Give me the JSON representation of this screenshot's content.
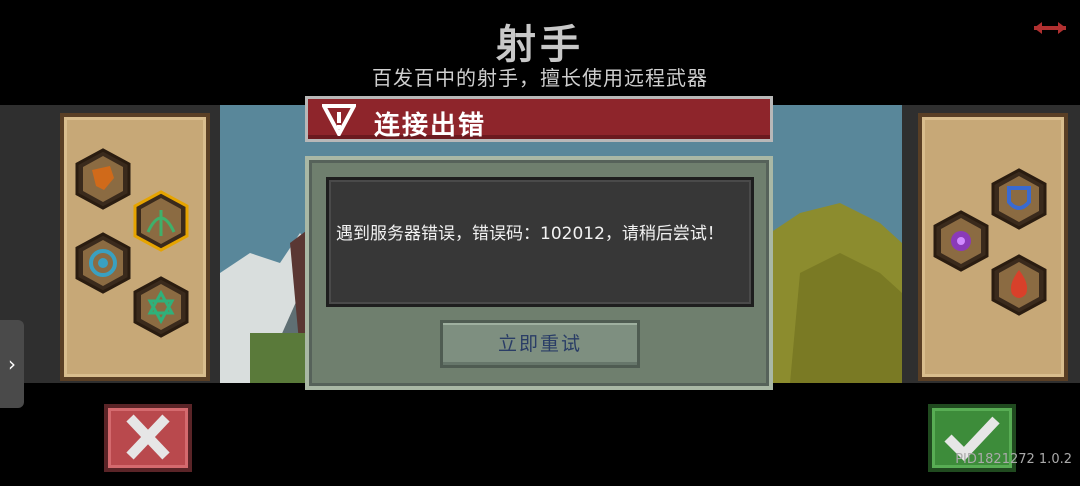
{
  "header": {
    "title": "射手",
    "subtitle": "百发百中的射手，擅长使用远程武器"
  },
  "dialog": {
    "title": "连接出错",
    "message": "遇到服务器错误，错误码：102012，请稍后尝试！",
    "retry_label": "立即重试"
  },
  "footer": {
    "version": "PID1821272 1.0.2"
  },
  "left_panel": {
    "icons": [
      "fire-fist-icon",
      "bow-icon",
      "whirlwind-icon",
      "hexagram-icon"
    ],
    "selected": "bow-icon"
  },
  "right_panel": {
    "icons": [
      "shield-icon",
      "poison-flower-icon",
      "flame-icon"
    ]
  },
  "colors": {
    "dialog_header": "#8e252b",
    "dialog_body": "#6f7f6e",
    "cancel": "#b9494d",
    "confirm": "#3d8c3a"
  }
}
